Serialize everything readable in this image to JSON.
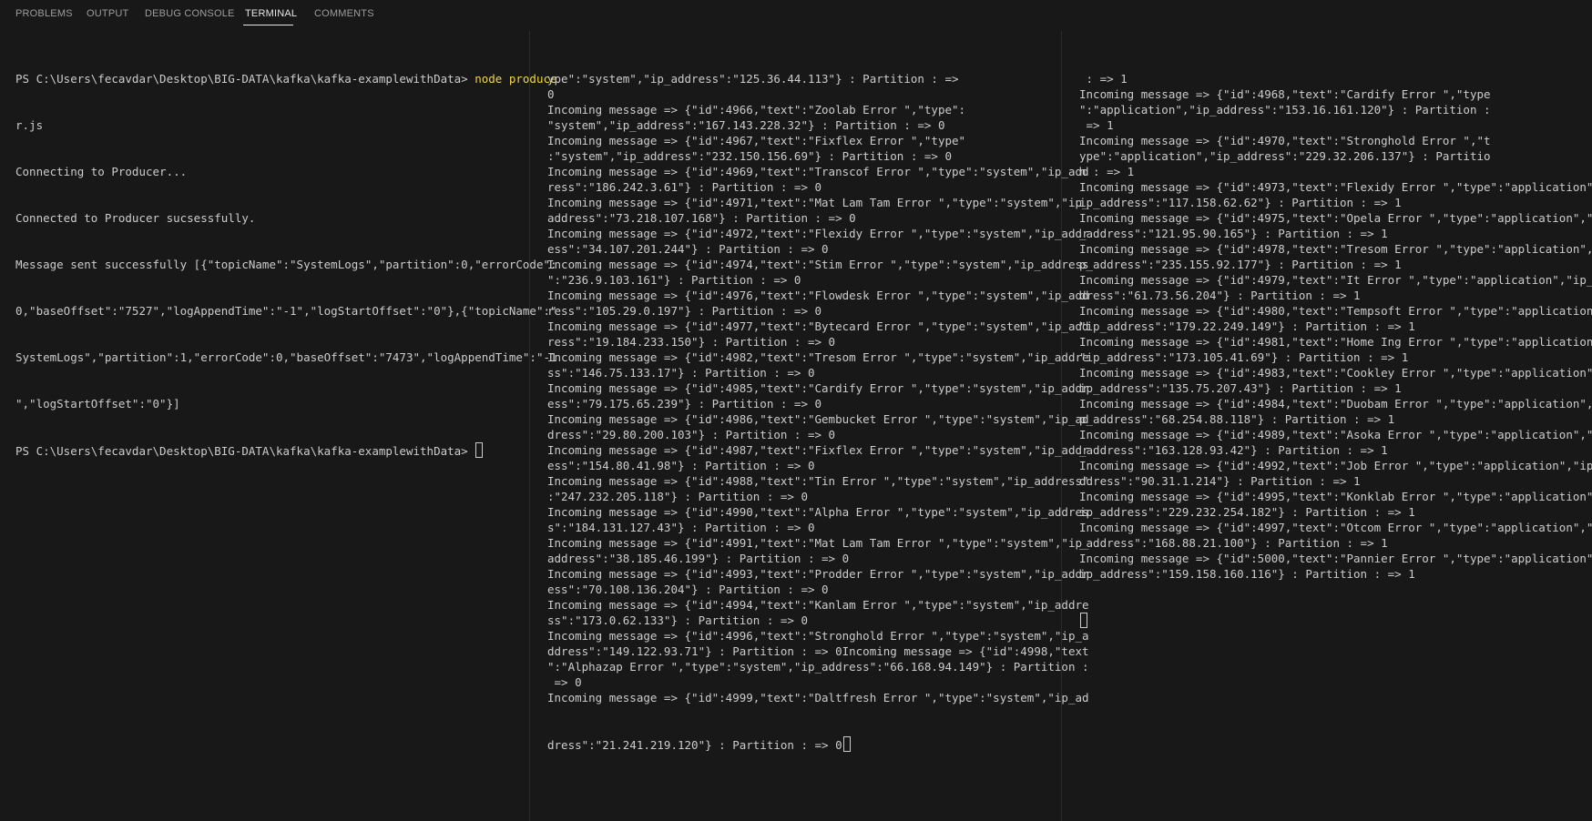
{
  "tabs": [
    {
      "label": "PROBLEMS",
      "active": false
    },
    {
      "label": "OUTPUT",
      "active": false
    },
    {
      "label": "DEBUG CONSOLE",
      "active": false
    },
    {
      "label": "TERMINAL",
      "active": true
    },
    {
      "label": "COMMENTS",
      "active": false
    }
  ],
  "colors": {
    "background": "#181818",
    "text": "#cccccc",
    "command": "#f0d64a",
    "tab_active": "#e7e7e7",
    "tab_inactive": "#9d9d9d"
  },
  "terminal1": {
    "prompt1": "PS C:\\Users\\fecavdar\\Desktop\\BIG-DATA\\kafka\\kafka-examplewithData> ",
    "command": "node produce",
    "command_wrap": "r.js",
    "lines": [
      "Connecting to Producer...",
      "Connected to Producer sucsessfully.",
      "Message sent successfully [{\"topicName\":\"SystemLogs\",\"partition\":0,\"errorCode\":",
      "0,\"baseOffset\":\"7527\",\"logAppendTime\":\"-1\",\"logStartOffset\":\"0\"},{\"topicName\":\"",
      "SystemLogs\",\"partition\":1,\"errorCode\":0,\"baseOffset\":\"7473\",\"logAppendTime\":\"-1",
      "\",\"logStartOffset\":\"0\"}]"
    ],
    "prompt2": "PS C:\\Users\\fecavdar\\Desktop\\BIG-DATA\\kafka\\kafka-examplewithData> "
  },
  "terminal2": {
    "lines": [
      "ype\":\"system\",\"ip_address\":\"125.36.44.113\"} : Partition : =>",
      "0",
      "Incoming message => {\"id\":4966,\"text\":\"Zoolab Error \",\"type\":",
      "\"system\",\"ip_address\":\"167.143.228.32\"} : Partition : => 0",
      "Incoming message => {\"id\":4967,\"text\":\"Fixflex Error \",\"type\"",
      ":\"system\",\"ip_address\":\"232.150.156.69\"} : Partition : => 0",
      "Incoming message => {\"id\":4969,\"text\":\"Transcof Error \",\"type\":\"system\",\"ip_add",
      "ress\":\"186.242.3.61\"} : Partition : => 0",
      "Incoming message => {\"id\":4971,\"text\":\"Mat Lam Tam Error \",\"type\":\"system\",\"ip_",
      "address\":\"73.218.107.168\"} : Partition : => 0",
      "Incoming message => {\"id\":4972,\"text\":\"Flexidy Error \",\"type\":\"system\",\"ip_addr",
      "ess\":\"34.107.201.244\"} : Partition : => 0",
      "Incoming message => {\"id\":4974,\"text\":\"Stim Error \",\"type\":\"system\",\"ip_address",
      "\":\"236.9.103.161\"} : Partition : => 0",
      "Incoming message => {\"id\":4976,\"text\":\"Flowdesk Error \",\"type\":\"system\",\"ip_add",
      "ress\":\"105.29.0.197\"} : Partition : => 0",
      "Incoming message => {\"id\":4977,\"text\":\"Bytecard Error \",\"type\":\"system\",\"ip_add",
      "ress\":\"19.184.233.150\"} : Partition : => 0",
      "Incoming message => {\"id\":4982,\"text\":\"Tresom Error \",\"type\":\"system\",\"ip_addre",
      "ss\":\"146.75.133.17\"} : Partition : => 0",
      "Incoming message => {\"id\":4985,\"text\":\"Cardify Error \",\"type\":\"system\",\"ip_addr",
      "ess\":\"79.175.65.239\"} : Partition : => 0",
      "Incoming message => {\"id\":4986,\"text\":\"Gembucket Error \",\"type\":\"system\",\"ip_ad",
      "dress\":\"29.80.200.103\"} : Partition : => 0",
      "Incoming message => {\"id\":4987,\"text\":\"Fixflex Error \",\"type\":\"system\",\"ip_addr",
      "ess\":\"154.80.41.98\"} : Partition : => 0",
      "Incoming message => {\"id\":4988,\"text\":\"Tin Error \",\"type\":\"system\",\"ip_address\"",
      ":\"247.232.205.118\"} : Partition : => 0",
      "Incoming message => {\"id\":4990,\"text\":\"Alpha Error \",\"type\":\"system\",\"ip_addres",
      "s\":\"184.131.127.43\"} : Partition : => 0",
      "Incoming message => {\"id\":4991,\"text\":\"Mat Lam Tam Error \",\"type\":\"system\",\"ip_",
      "address\":\"38.185.46.199\"} : Partition : => 0",
      "Incoming message => {\"id\":4993,\"text\":\"Prodder Error \",\"type\":\"system\",\"ip_addr",
      "ess\":\"70.108.136.204\"} : Partition : => 0",
      "Incoming message => {\"id\":4994,\"text\":\"Kanlam Error \",\"type\":\"system\",\"ip_addre",
      "ss\":\"173.0.62.133\"} : Partition : => 0",
      "Incoming message => {\"id\":4996,\"text\":\"Stronghold Error \",\"type\":\"system\",\"ip_a",
      "ddress\":\"149.122.93.71\"} : Partition : => 0Incoming message => {\"id\":4998,\"text",
      "\":\"Alphazap Error \",\"type\":\"system\",\"ip_address\":\"66.168.94.149\"} : Partition :",
      " => 0",
      "Incoming message => {\"id\":4999,\"text\":\"Daltfresh Error \",\"type\":\"system\",\"ip_ad"
    ],
    "last_line": "dress\":\"21.241.219.120\"} : Partition : => 0"
  },
  "terminal3": {
    "lines": [
      " : => 1",
      "Incoming message => {\"id\":4968,\"text\":\"Cardify Error \",\"type",
      "\":\"application\",\"ip_address\":\"153.16.161.120\"} : Partition :",
      " => 1",
      "Incoming message => {\"id\":4970,\"text\":\"Stronghold Error \",\"t",
      "ype\":\"application\",\"ip_address\":\"229.32.206.137\"} : Partitio",
      "n : => 1",
      "Incoming message => {\"id\":4973,\"text\":\"Flexidy Error \",\"type\":\"application\",\"",
      "ip_address\":\"117.158.62.62\"} : Partition : => 1",
      "Incoming message => {\"id\":4975,\"text\":\"Opela Error \",\"type\":\"application\",\"ip",
      "_address\":\"121.95.90.165\"} : Partition : => 1",
      "Incoming message => {\"id\":4978,\"text\":\"Tresom Error \",\"type\":\"application\",\"i",
      "p_address\":\"235.155.92.177\"} : Partition : => 1",
      "Incoming message => {\"id\":4979,\"text\":\"It Error \",\"type\":\"application\",\"ip_ad",
      "dress\":\"61.73.56.204\"} : Partition : => 1",
      "Incoming message => {\"id\":4980,\"text\":\"Tempsoft Error \",\"type\":\"application\",",
      "\"ip_address\":\"179.22.249.149\"} : Partition : => 1",
      "Incoming message => {\"id\":4981,\"text\":\"Home Ing Error \",\"type\":\"application\",",
      "\"ip_address\":\"173.105.41.69\"} : Partition : => 1",
      "Incoming message => {\"id\":4983,\"text\":\"Cookley Error \",\"type\":\"application\",\"",
      "ip_address\":\"135.75.207.43\"} : Partition : => 1",
      "Incoming message => {\"id\":4984,\"text\":\"Duobam Error \",\"type\":\"application\",\"i",
      "p_address\":\"68.254.88.118\"} : Partition : => 1",
      "Incoming message => {\"id\":4989,\"text\":\"Asoka Error \",\"type\":\"application\",\"ip",
      "_address\":\"163.128.93.42\"} : Partition : => 1",
      "Incoming message => {\"id\":4992,\"text\":\"Job Error \",\"type\":\"application\",\"ip_a",
      "ddress\":\"90.31.1.214\"} : Partition : => 1",
      "Incoming message => {\"id\":4995,\"text\":\"Konklab Error \",\"type\":\"application\",\"",
      "ip_address\":\"229.232.254.182\"} : Partition : => 1",
      "Incoming message => {\"id\":4997,\"text\":\"Otcom Error \",\"type\":\"application\",\"ip",
      "_address\":\"168.88.21.100\"} : Partition : => 1",
      "Incoming message => {\"id\":5000,\"text\":\"Pannier Error \",\"type\":\"application\",\"",
      "ip_address\":\"159.158.160.116\"} : Partition : => 1"
    ]
  }
}
